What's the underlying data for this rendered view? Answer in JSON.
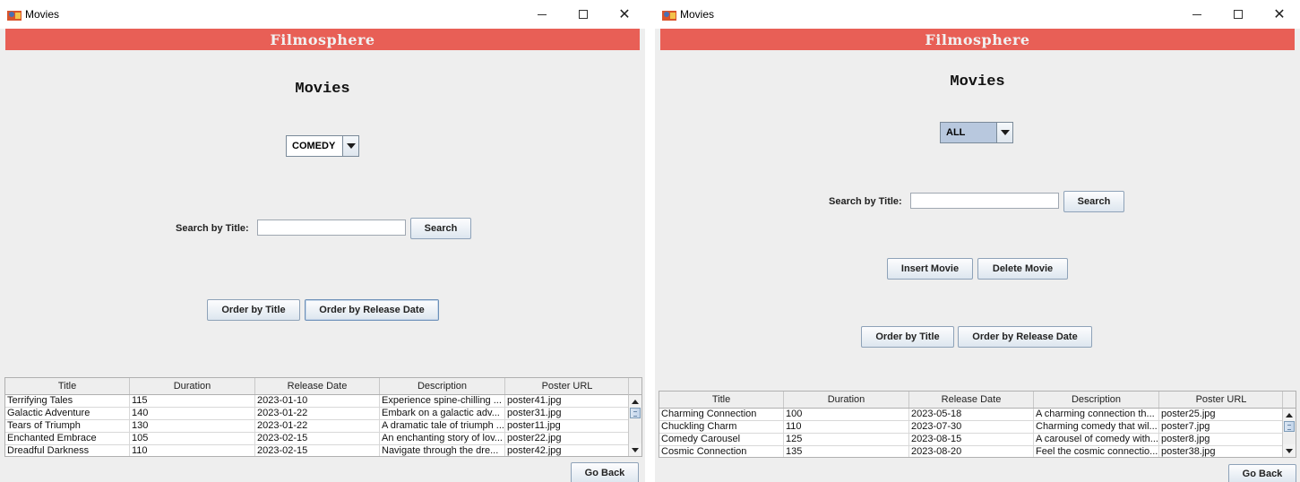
{
  "windows": [
    {
      "title": "Movies",
      "banner": "Filmosphere",
      "heading": "Movies",
      "genre_selected": "COMEDY",
      "search_label": "Search by Title:",
      "search_value": "",
      "search_button": "Search",
      "order_title_button": "Order by Title",
      "order_date_button": "Order by Release Date",
      "go_back_button": "Go Back",
      "columns": [
        "Title",
        "Duration",
        "Release Date",
        "Description",
        "Poster URL"
      ],
      "rows": [
        [
          "Terrifying Tales",
          "115",
          "2023-01-10",
          "Experience spine-chilling ...",
          "poster41.jpg"
        ],
        [
          "Galactic Adventure",
          "140",
          "2023-01-22",
          "Embark on a galactic adv...",
          "poster31.jpg"
        ],
        [
          "Tears of Triumph",
          "130",
          "2023-01-22",
          "A dramatic tale of triumph ...",
          "poster11.jpg"
        ],
        [
          "Enchanted Embrace",
          "105",
          "2023-02-15",
          "An enchanting story of lov...",
          "poster22.jpg"
        ],
        [
          "Dreadful Darkness",
          "110",
          "2023-02-15",
          "Navigate through the dre...",
          "poster42.jpg"
        ]
      ]
    },
    {
      "title": "Movies",
      "banner": "Filmosphere",
      "heading": "Movies",
      "genre_selected": "ALL",
      "search_label": "Search by Title:",
      "search_value": "",
      "search_button": "Search",
      "insert_button": "Insert Movie",
      "delete_button": "Delete Movie",
      "order_title_button": "Order by Title",
      "order_date_button": "Order by Release Date",
      "go_back_button": "Go Back",
      "columns": [
        "Title",
        "Duration",
        "Release Date",
        "Description",
        "Poster URL"
      ],
      "rows": [
        [
          "Charming Connection",
          "100",
          "2023-05-18",
          "A charming connection th...",
          "poster25.jpg"
        ],
        [
          "Chuckling Charm",
          "110",
          "2023-07-30",
          "Charming comedy that wil...",
          "poster7.jpg"
        ],
        [
          "Comedy Carousel",
          "125",
          "2023-08-15",
          "A carousel of comedy with...",
          "poster8.jpg"
        ],
        [
          "Cosmic Connection",
          "135",
          "2023-08-20",
          "Feel the cosmic connectio...",
          "poster38.jpg"
        ]
      ]
    }
  ]
}
